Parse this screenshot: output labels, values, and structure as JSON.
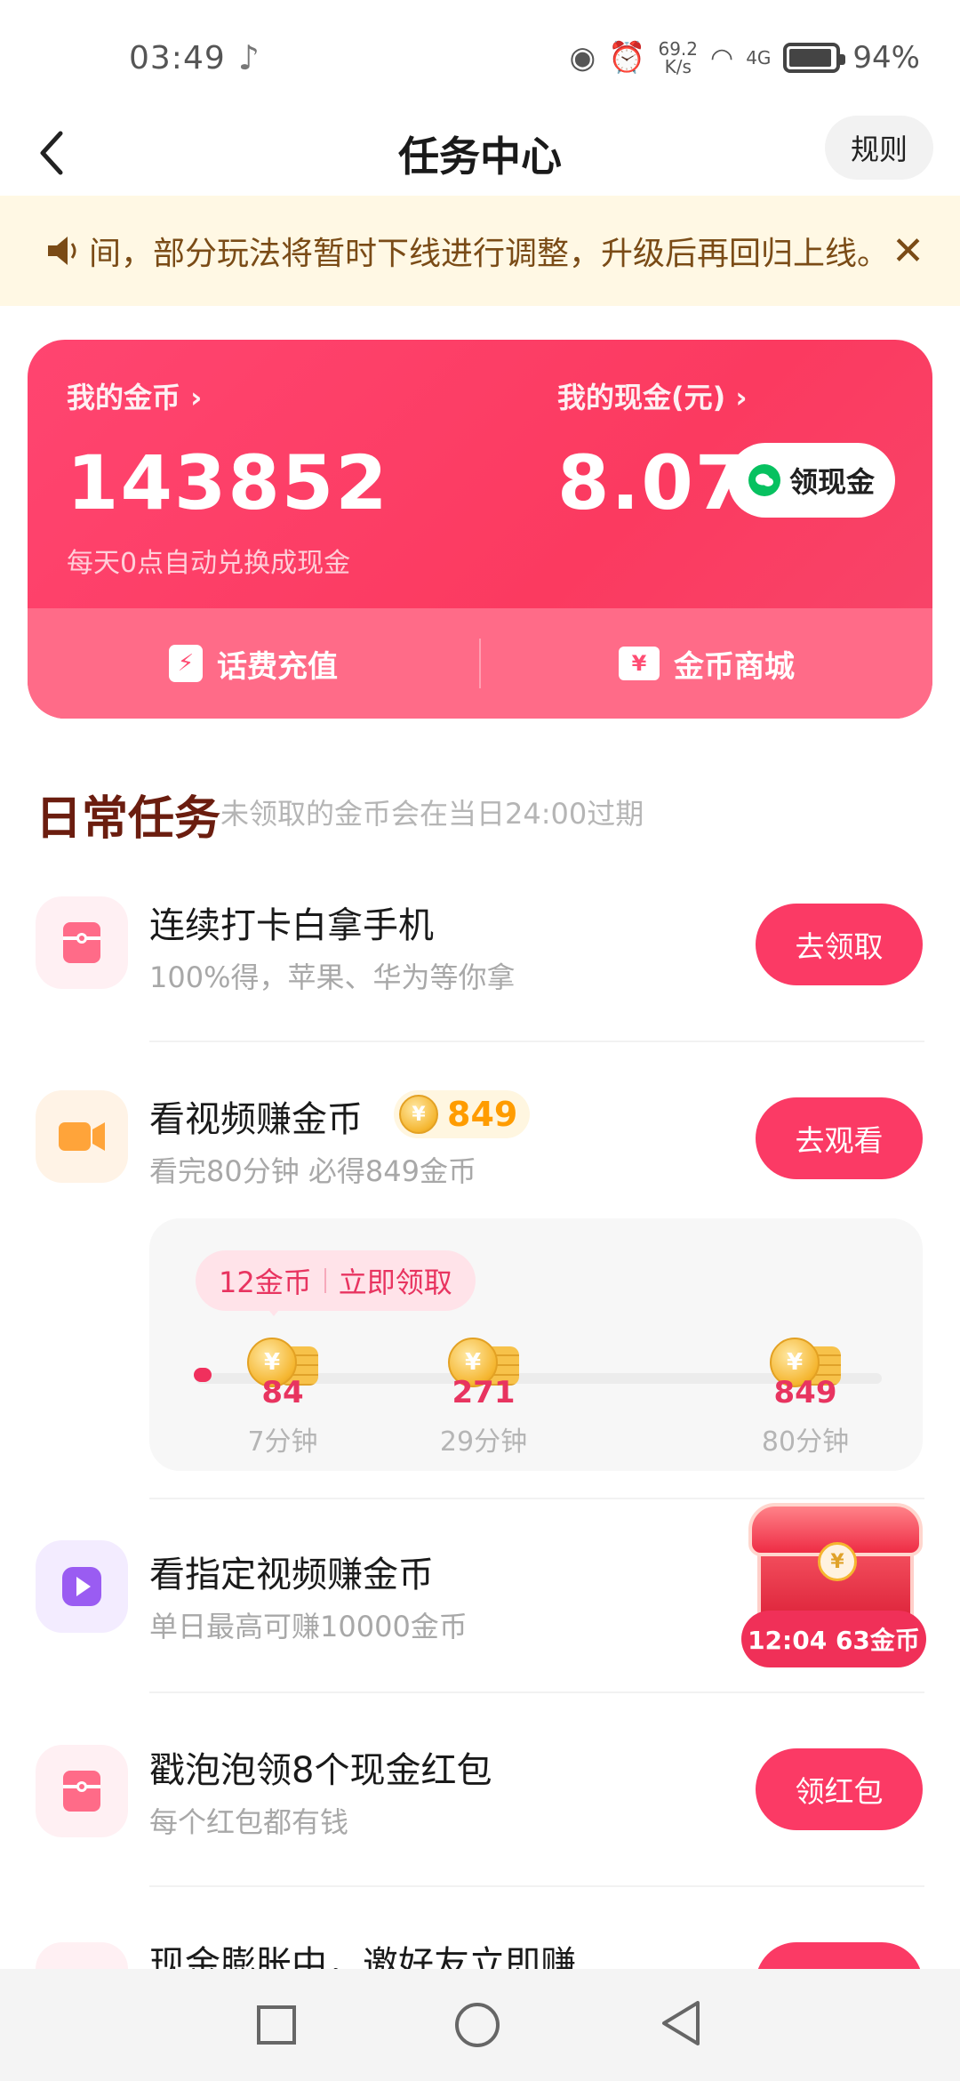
{
  "status_bar": {
    "time": "03:49",
    "net_speed_top": "69.2",
    "net_speed_bottom": "K/s",
    "signal": "4G",
    "battery_pct": "94%",
    "battery_level": 0.94
  },
  "header": {
    "title": "任务中心",
    "rules_label": "规则"
  },
  "notice": {
    "text": "间，部分玩法将暂时下线进行调整，升级后再回归上线。",
    "close_glyph": "✕"
  },
  "wallet": {
    "coins_label": "我的金币 ›",
    "coins_value": "143852",
    "cash_label": "我的现金(元) ›",
    "cash_value": "8.07",
    "withdraw_label": "领现金",
    "hint": "每天0点自动兑换成现金",
    "recharge_label": "话费充值",
    "mall_label": "金币商城"
  },
  "daily": {
    "title": "日常任务",
    "subtitle": "未领取的金币会在当日24:00过期"
  },
  "tasks": [
    {
      "name": "连续打卡白拿手机",
      "desc": "100%得，苹果、华为等你拿",
      "button": "去领取"
    },
    {
      "name": "看视频赚金币",
      "badge": "849",
      "desc": "看完80分钟 必得849金币",
      "button": "去观看"
    },
    {
      "name": "看指定视频赚金币",
      "desc": "单日最高可赚10000金币",
      "chest_label": "12:04 63金币"
    },
    {
      "name": "戳泡泡领8个现金红包",
      "desc": "每个红包都有钱",
      "button": "领红包"
    },
    {
      "name": "现金膨胀中，邀好友立即赚"
    }
  ],
  "progress": {
    "bubble_coins": "12金币",
    "bubble_action": "立即领取",
    "milestones": [
      {
        "coins": "84",
        "time": "7分钟"
      },
      {
        "coins": "271",
        "time": "29分钟"
      },
      {
        "coins": "849",
        "time": "80分钟"
      }
    ]
  },
  "colors": {
    "accent": "#fb3a65",
    "wallet_bg": "#ff4570",
    "notice_bg": "#fff8e4",
    "coin_gold": "#f5b630"
  },
  "icons": [
    "back-icon",
    "speaker-icon",
    "close-icon",
    "wechat-icon",
    "phone-bill-icon",
    "ticket-icon",
    "gift-icon",
    "video-icon",
    "play-icon",
    "coin-icon",
    "treasure-chest-icon"
  ]
}
